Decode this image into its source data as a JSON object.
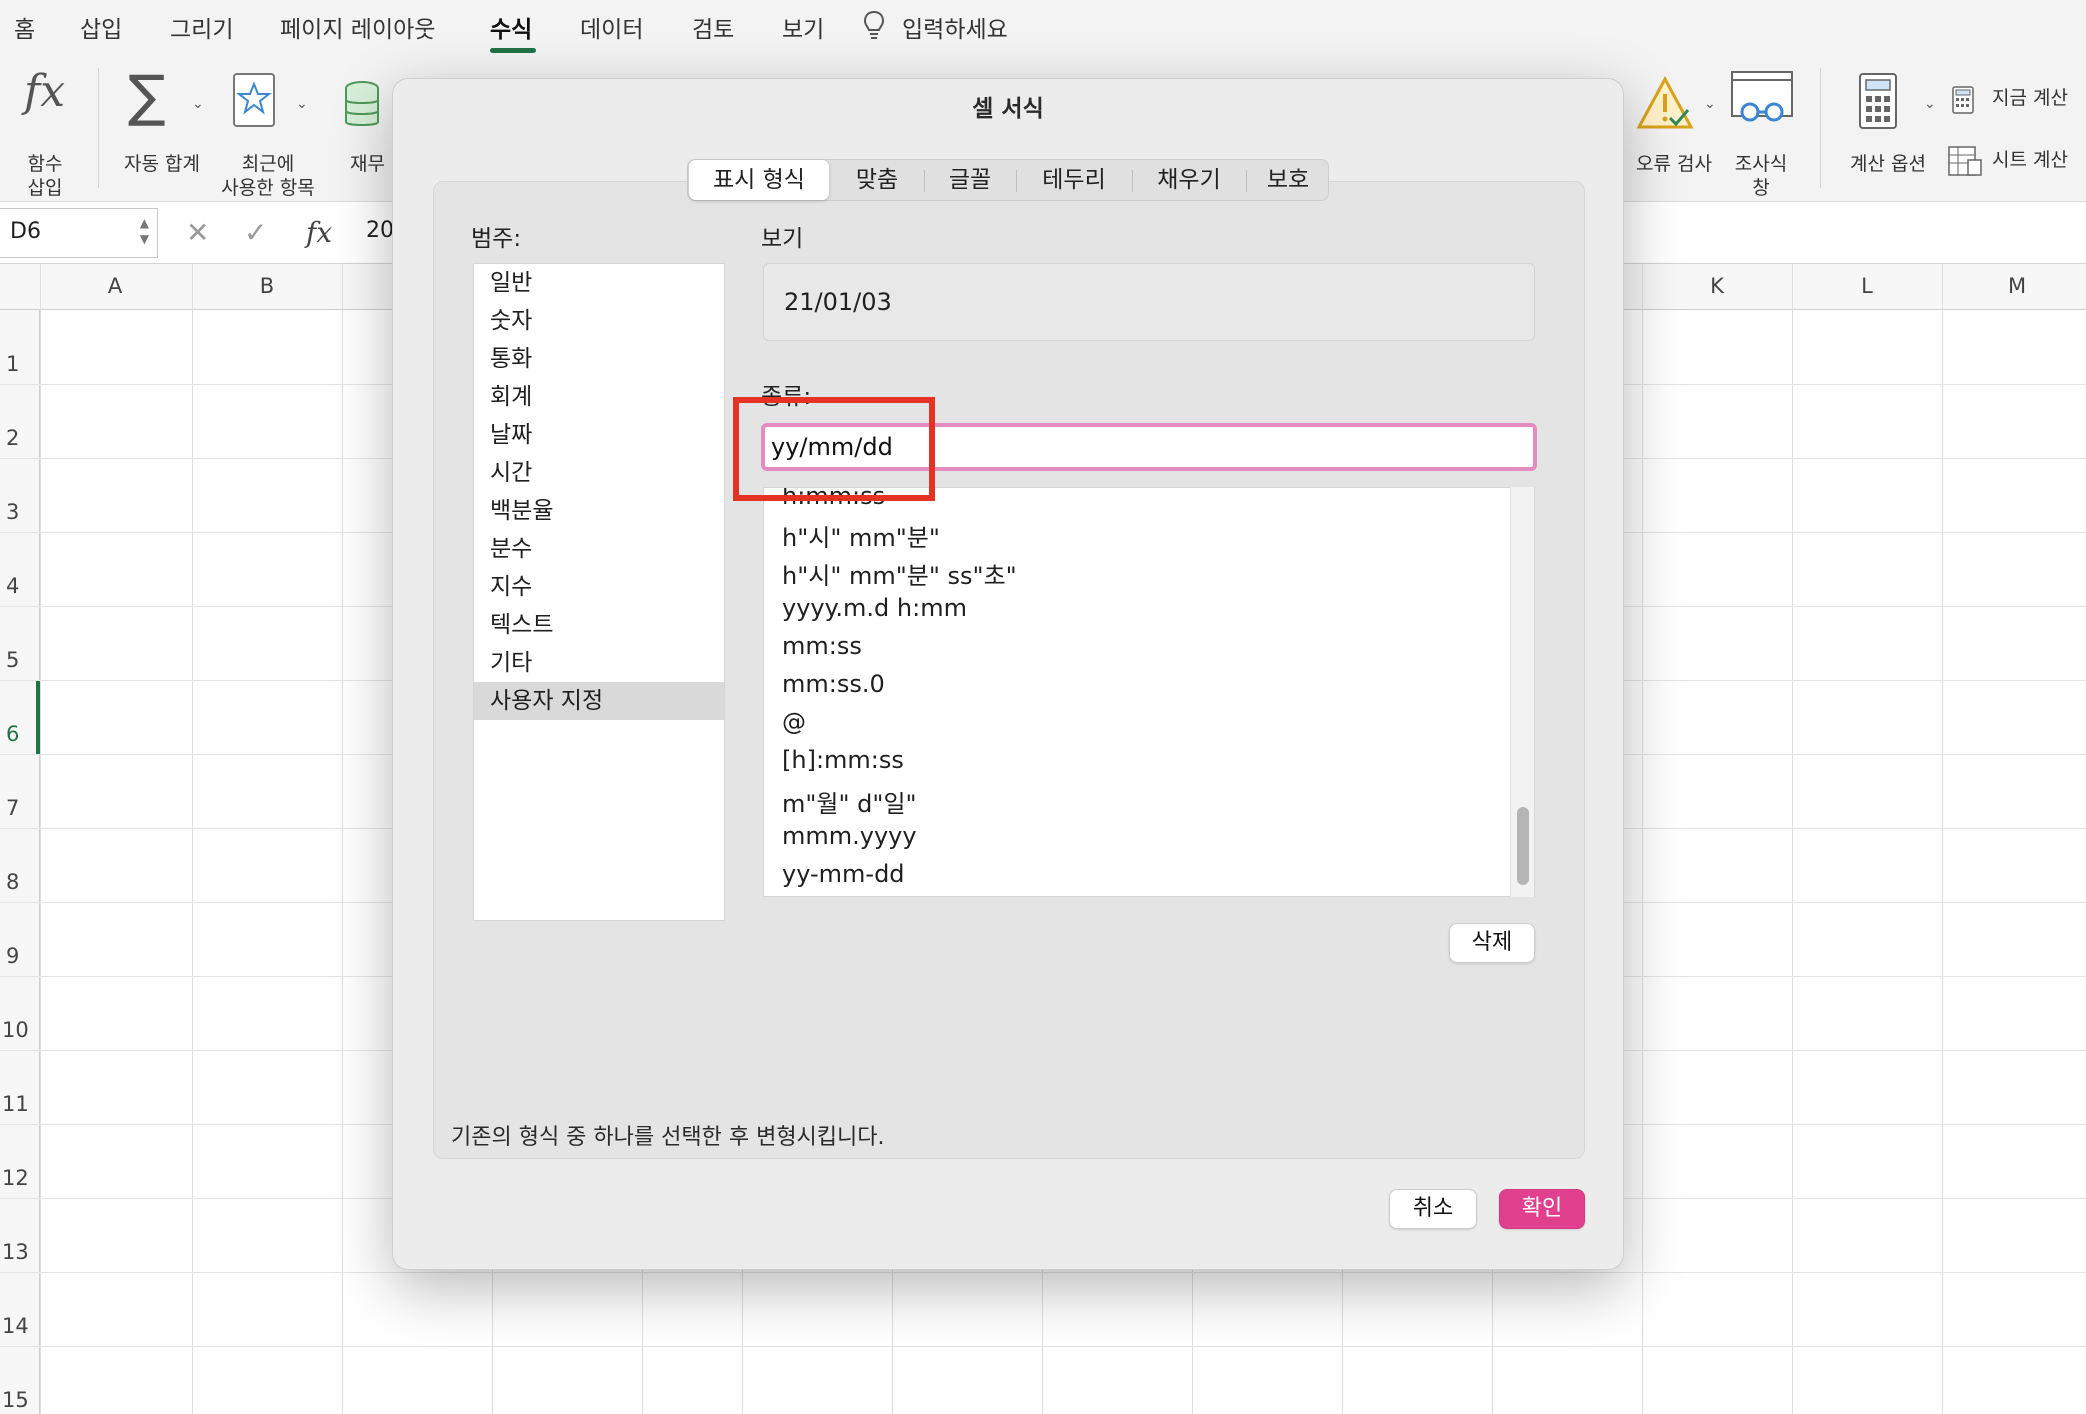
{
  "ribbon_tabs": [
    "홈",
    "삽입",
    "그리기",
    "페이지 레이아웃",
    "수식",
    "데이터",
    "검토",
    "보기"
  ],
  "tell_me": "입력하세요",
  "ribbon": {
    "insert_function": "함수\n삽입",
    "autosum": "자동 합계",
    "recent": "최근에\n사용한 항목",
    "financial": "재무",
    "error_check": "오류 검사",
    "watch_window": "조사식\n창",
    "calc_options": "계산 옵션",
    "calc_now": "지금 계산",
    "calc_sheet": "시트 계산"
  },
  "formula_bar": {
    "name_box": "D6",
    "value": "20"
  },
  "columns": [
    "A",
    "B",
    "K",
    "L",
    "M"
  ],
  "rows": [
    "1",
    "2",
    "3",
    "4",
    "5",
    "6",
    "7",
    "8",
    "9",
    "10",
    "11",
    "12",
    "13",
    "14",
    "15"
  ],
  "dialog": {
    "title": "셀 서식",
    "tabs": [
      "표시 형식",
      "맞춤",
      "글꼴",
      "테두리",
      "채우기",
      "보호"
    ],
    "category_label": "범주:",
    "categories": [
      "일반",
      "숫자",
      "통화",
      "회계",
      "날짜",
      "시간",
      "백분율",
      "분수",
      "지수",
      "텍스트",
      "기타",
      "사용자 지정"
    ],
    "selected_category": "사용자 지정",
    "preview_label": "보기",
    "preview_value": "21/01/03",
    "type_label": "종류:",
    "type_value": "yy/mm/dd",
    "formats": [
      "h:mm:ss",
      "h\"시\" mm\"분\"",
      "h\"시\" mm\"분\" ss\"초\"",
      "yyyy.m.d h:mm",
      "mm:ss",
      "mm:ss.0",
      "@",
      "[h]:mm:ss",
      "m\"월\" d\"일\"",
      "mmm.yyyy",
      "yy-mm-dd"
    ],
    "delete_button": "삭제",
    "description": "기존의 형식 중 하나를 선택한 후 변형시킵니다.",
    "cancel_button": "취소",
    "ok_button": "확인"
  },
  "colors": {
    "accent": "#217346",
    "ok": "#e0408e",
    "focus_ring": "#e48cc0",
    "highlight": "#e53323"
  }
}
